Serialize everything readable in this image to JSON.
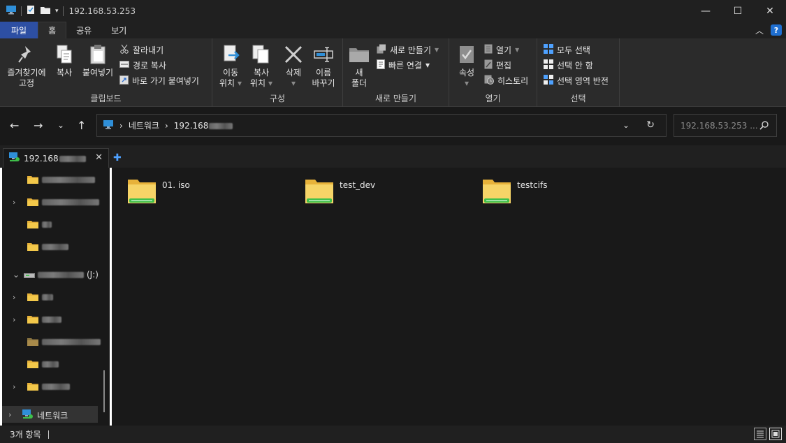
{
  "window": {
    "title": "192.168.53.253",
    "controls": {
      "minimize": "—",
      "maximize": "☐",
      "close": "✕"
    }
  },
  "ribbon_tabs": [
    {
      "label": "파일"
    },
    {
      "label": "홈"
    },
    {
      "label": "공유"
    },
    {
      "label": "보기"
    }
  ],
  "ribbon": {
    "clipboard": {
      "group_label": "클립보드",
      "pin_line1": "즐겨찾기에",
      "pin_line2": "고정",
      "copy": "복사",
      "paste": "붙여넣기",
      "cut": "잘라내기",
      "copy_path": "경로 복사",
      "paste_shortcut": "바로 가기 붙여넣기"
    },
    "organize": {
      "group_label": "구성",
      "move_line1": "이동",
      "move_line2": "위치",
      "copy_line1": "복사",
      "copy_line2": "위치",
      "delete_line1": "삭제",
      "rename_line1": "이름",
      "rename_line2": "바꾸기"
    },
    "new": {
      "group_label": "새로 만들기",
      "new_folder_line1": "새",
      "new_folder_line2": "폴더",
      "new_item": "새로 만들기",
      "easy_access": "빠른 연결"
    },
    "open": {
      "group_label": "열기",
      "properties": "속성",
      "open": "열기",
      "edit": "편집",
      "history": "히스토리"
    },
    "select": {
      "group_label": "선택",
      "select_all": "모두 선택",
      "select_none": "선택 안 함",
      "invert": "선택 영역 반전"
    }
  },
  "address": {
    "root": "네트워크",
    "host_prefix": "192.168",
    "search_placeholder": "192.168.53.253 ..."
  },
  "tab": {
    "label_prefix": "192.168"
  },
  "nav": {
    "drive_suffix": "(J:)",
    "network_label": "네트워크"
  },
  "folders": [
    {
      "name": "01. iso"
    },
    {
      "name": "test_dev"
    },
    {
      "name": "testcifs"
    }
  ],
  "status": {
    "item_count": "3개 항목"
  },
  "colors": {
    "file_tab": "#2d4fa3",
    "folder_yellow": "#f3c84a",
    "network_green": "#3fbf4a",
    "accent_blue": "#4ea1ff"
  }
}
